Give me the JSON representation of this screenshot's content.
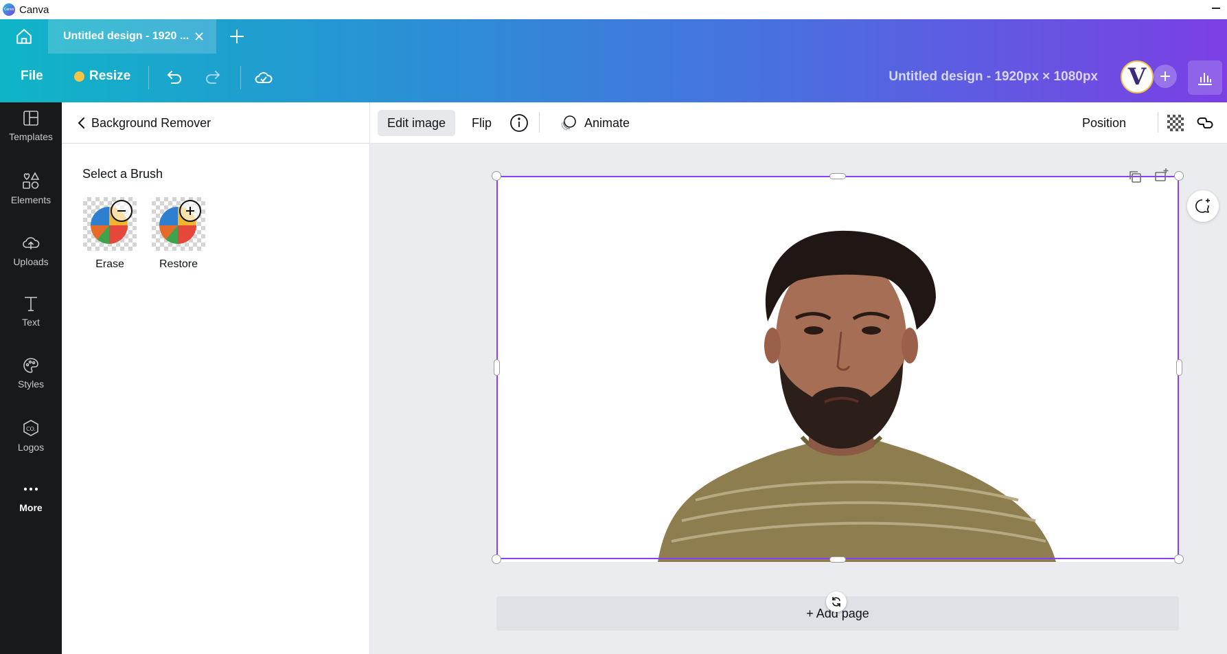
{
  "window": {
    "app_title": "Canva",
    "logo_text": "Canva"
  },
  "tabs": [
    {
      "title": "Untitled design - 1920 ..."
    }
  ],
  "toolbar": {
    "file_label": "File",
    "resize_label": "Resize",
    "design_title": "Untitled design - 1920px × 1080px",
    "avatar_letter": "V"
  },
  "sidebar": {
    "items": [
      {
        "label": "Templates",
        "icon": "templates-icon"
      },
      {
        "label": "Elements",
        "icon": "elements-icon"
      },
      {
        "label": "Uploads",
        "icon": "uploads-icon"
      },
      {
        "label": "Text",
        "icon": "text-icon"
      },
      {
        "label": "Styles",
        "icon": "styles-icon"
      },
      {
        "label": "Logos",
        "icon": "logos-icon"
      },
      {
        "label": "More",
        "icon": "more-icon"
      }
    ]
  },
  "panel": {
    "title": "Background Remover",
    "brush_heading": "Select a Brush",
    "brushes": [
      {
        "label": "Erase",
        "icon": "minus-icon"
      },
      {
        "label": "Restore",
        "icon": "plus-icon"
      }
    ]
  },
  "context_toolbar": {
    "edit_image": "Edit image",
    "flip": "Flip",
    "animate": "Animate",
    "position": "Position"
  },
  "canvas": {
    "add_page": "+ Add page",
    "selection_color": "#8b3dff"
  },
  "colors": {
    "gradient_start": "#0fb5c7",
    "gradient_end": "#7b3fe4",
    "sidebar_bg": "#18191b",
    "workspace_bg": "#ebecf0"
  }
}
